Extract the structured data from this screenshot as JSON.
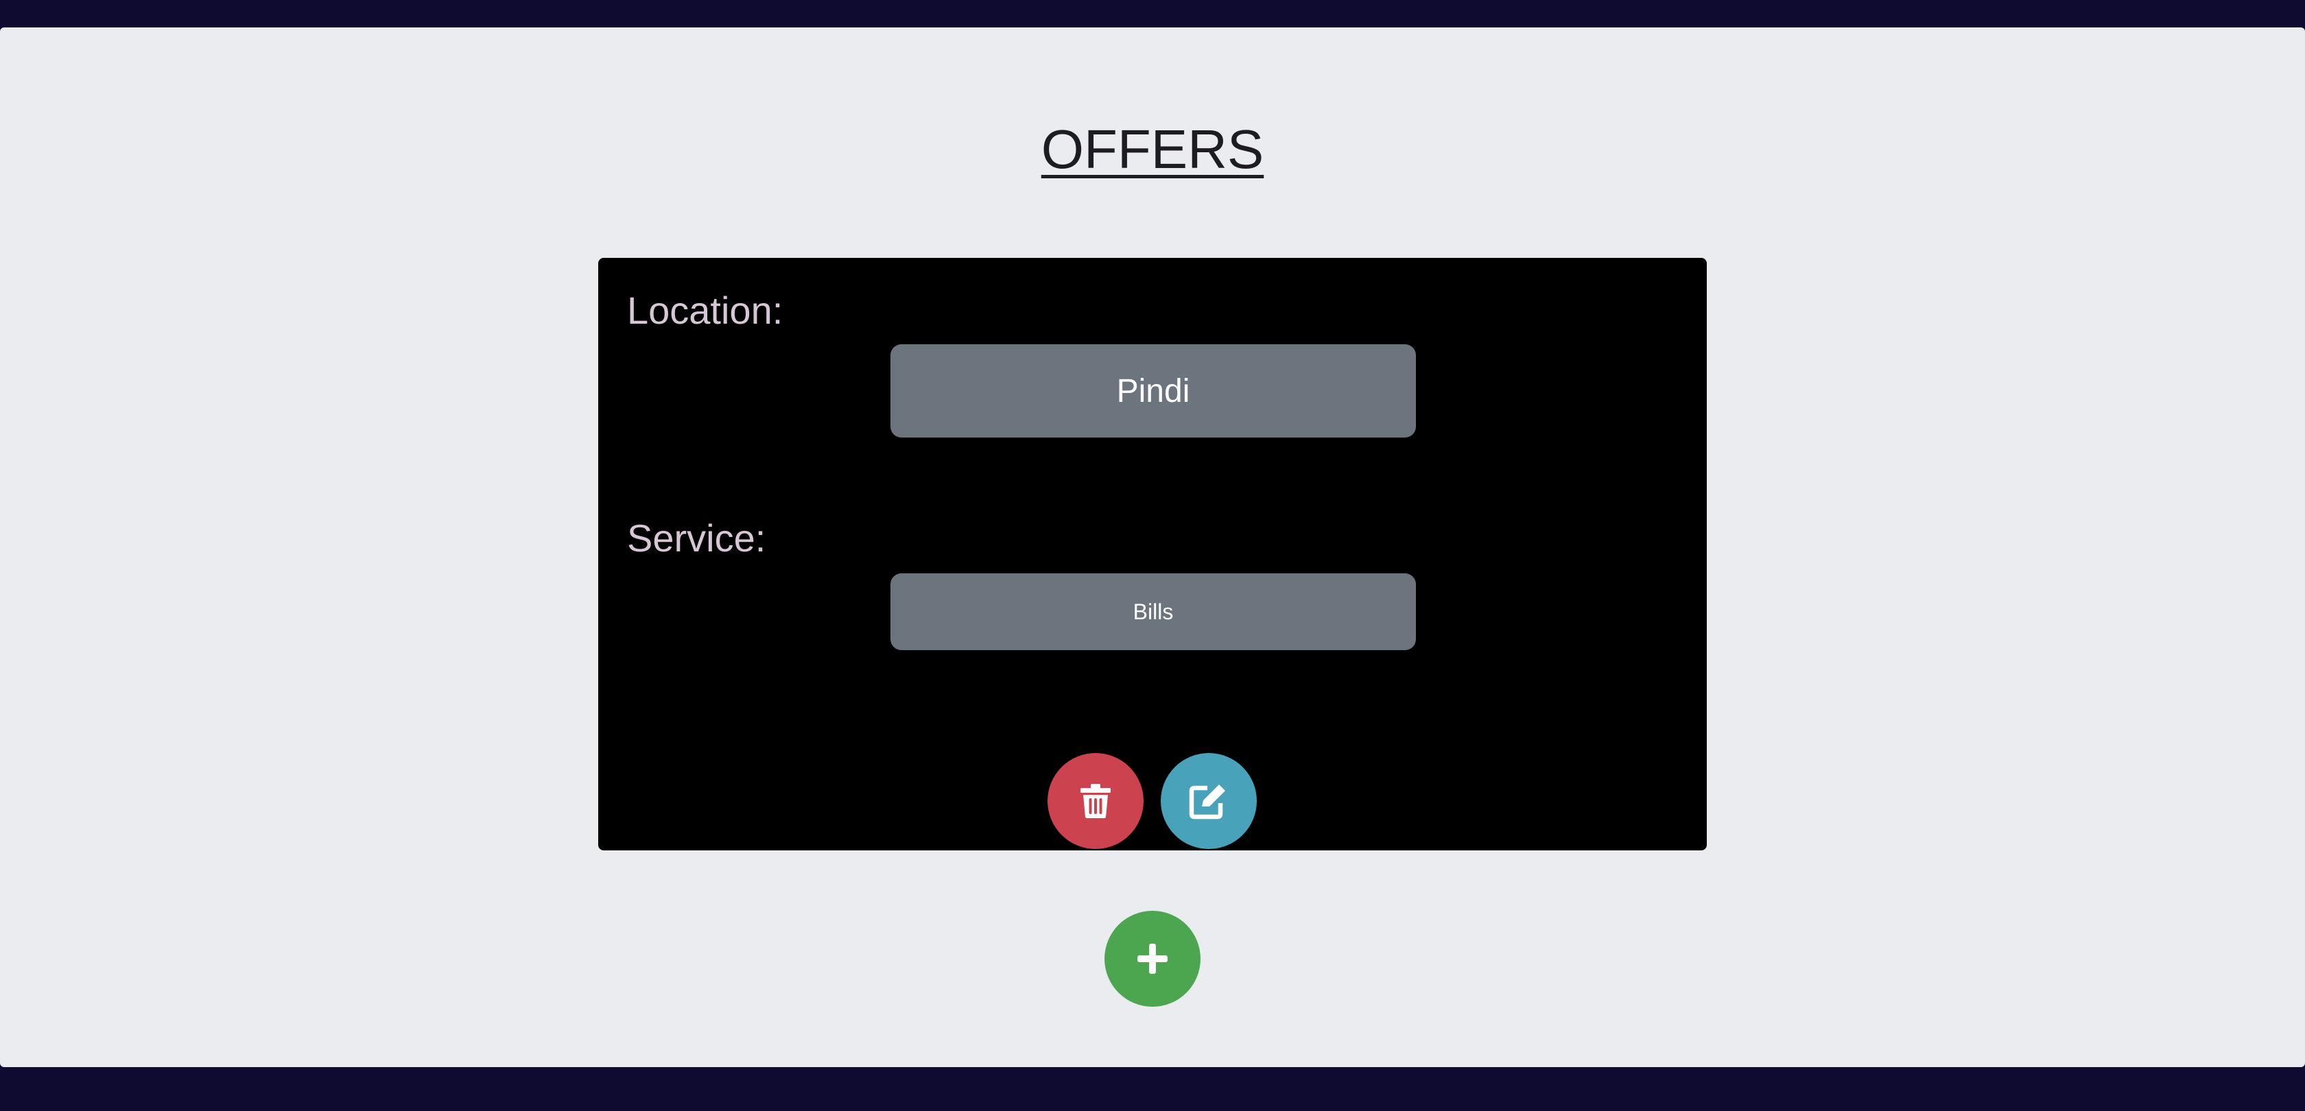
{
  "page": {
    "title": "OFFERS"
  },
  "offer_card": {
    "location_label": "Location:",
    "location_value": "Pindi",
    "service_label": "Service:",
    "service_value": "Bills",
    "delete_icon": "trash-icon",
    "edit_icon": "edit-icon"
  },
  "actions": {
    "add_icon": "plus-icon"
  },
  "colors": {
    "frame": "#0f0a30",
    "background": "#ebecf0",
    "card": "#000000",
    "value_box": "#6c757d",
    "label_text": "#d7c6d6",
    "delete": "#cc434f",
    "edit": "#48a2b9",
    "add": "#4ca64f"
  }
}
